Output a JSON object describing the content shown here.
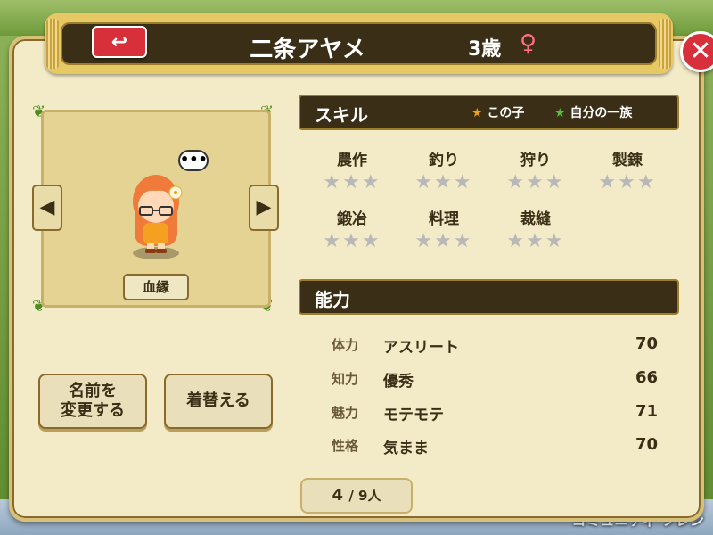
{
  "header": {
    "back_icon": "back-arrow-icon",
    "name": "二条アヤメ",
    "age": "3歳",
    "gender_symbol": "♀",
    "close_icon": "close-x-icon"
  },
  "portrait": {
    "speech_bubble": "•••",
    "bloodline_label": "血縁",
    "left_arrow": "◀",
    "right_arrow": "▶"
  },
  "buttons": {
    "rename_line1": "名前を",
    "rename_line2": "変更する",
    "change_clothes": "着替える"
  },
  "skills": {
    "title": "スキル",
    "legend_child": "この子",
    "legend_family": "自分の一族",
    "items": [
      {
        "name": "農作",
        "stars": "★★★"
      },
      {
        "name": "釣り",
        "stars": "★★★"
      },
      {
        "name": "狩り",
        "stars": "★★★"
      },
      {
        "name": "製錬",
        "stars": "★★★"
      },
      {
        "name": "鍛冶",
        "stars": "★★★"
      },
      {
        "name": "料理",
        "stars": "★★★"
      },
      {
        "name": "裁縫",
        "stars": "★★★"
      }
    ]
  },
  "abilities": {
    "title": "能力",
    "rows": [
      {
        "label": "体力",
        "value": "アスリート",
        "num": "70"
      },
      {
        "label": "知力",
        "value": "優秀",
        "num": "66"
      },
      {
        "label": "魅力",
        "value": "モテモテ",
        "num": "71"
      },
      {
        "label": "性格",
        "value": "気まま",
        "num": "70"
      }
    ]
  },
  "pager": {
    "current": "4",
    "total": "/ 9人"
  },
  "background": {
    "community_label": "コミュニティ フレン"
  },
  "colors": {
    "header_dark": "#3a2f16",
    "dialog_bg": "#f3ebc7",
    "accent_red": "#d7303a",
    "gender_pink": "#ff6e86"
  }
}
